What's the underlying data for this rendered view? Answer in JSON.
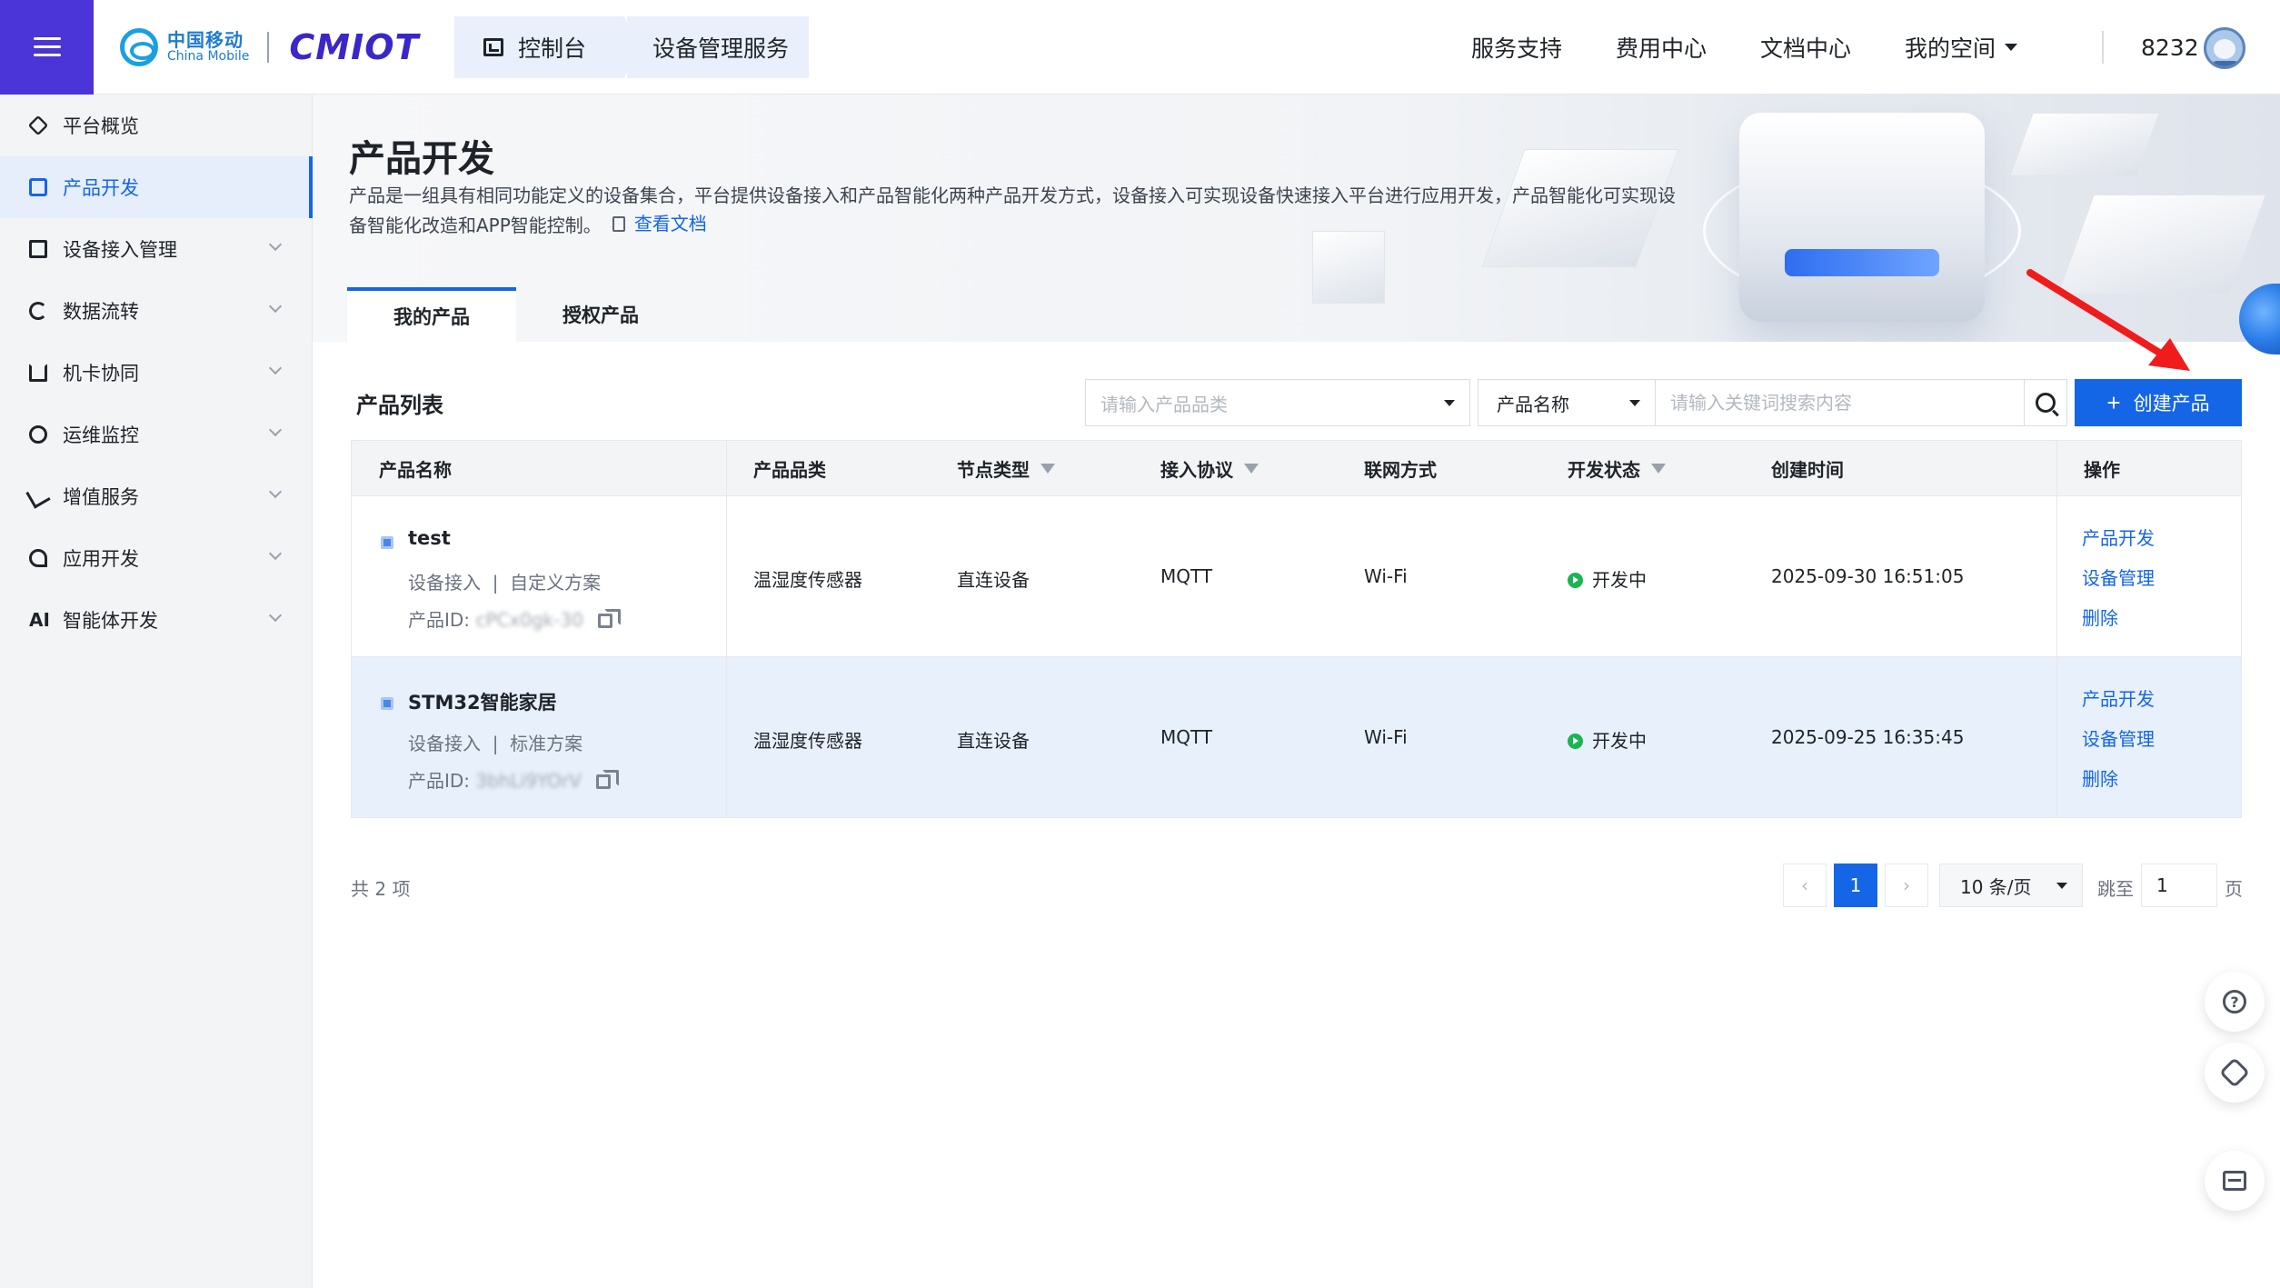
{
  "header": {
    "brand_cn": "中国移动",
    "brand_en": "China Mobile",
    "product_logo": "CMIOT",
    "breadcrumb": [
      {
        "label": "控制台",
        "icon": "console-icon"
      },
      {
        "label": "设备管理服务"
      }
    ],
    "nav": {
      "service": "服务支持",
      "fee": "费用中心",
      "docs": "文档中心",
      "space": "我的空间"
    },
    "user_id": "8232"
  },
  "sidebar": {
    "items": [
      {
        "label": "平台概览",
        "icon": "overview-icon",
        "expandable": false,
        "active": false
      },
      {
        "label": "产品开发",
        "icon": "product-icon",
        "expandable": false,
        "active": true
      },
      {
        "label": "设备接入管理",
        "icon": "device-access-icon",
        "expandable": true,
        "active": false
      },
      {
        "label": "数据流转",
        "icon": "data-flow-icon",
        "expandable": true,
        "active": false
      },
      {
        "label": "机卡协同",
        "icon": "card-sync-icon",
        "expandable": true,
        "active": false
      },
      {
        "label": "运维监控",
        "icon": "monitor-icon",
        "expandable": true,
        "active": false
      },
      {
        "label": "增值服务",
        "icon": "value-added-icon",
        "expandable": true,
        "active": false
      },
      {
        "label": "应用开发",
        "icon": "app-dev-icon",
        "expandable": true,
        "active": false
      },
      {
        "label": "智能体开发",
        "icon": "ai-icon",
        "icon_text": "AI",
        "expandable": true,
        "active": false
      }
    ]
  },
  "page": {
    "title": "产品开发",
    "description": "产品是一组具有相同功能定义的设备集合，平台提供设备接入和产品智能化两种产品开发方式，设备接入可实现设备快速接入平台进行应用开发，产品智能化可实现设备智能化改造和APP智能控制。",
    "doc_link": "查看文档",
    "tabs": [
      {
        "label": "我的产品",
        "active": true
      },
      {
        "label": "授权产品",
        "active": false
      }
    ]
  },
  "toolbar": {
    "list_title": "产品列表",
    "category_placeholder": "请输入产品品类",
    "search_field": "产品名称",
    "search_placeholder": "请输入关键词搜索内容",
    "create_label": "创建产品",
    "accent_color": "#1466e6"
  },
  "table": {
    "columns": {
      "name": "产品名称",
      "category": "产品品类",
      "node": "节点类型",
      "protocol": "接入协议",
      "network": "联网方式",
      "status": "开发状态",
      "created": "创建时间",
      "ops": "操作"
    },
    "rows": [
      {
        "name": "test",
        "access": "设备接入",
        "scheme": "自定义方案",
        "id_label": "产品ID:",
        "id_value": "cPCx0gk-30",
        "category": "温湿度传感器",
        "node": "直连设备",
        "protocol": "MQTT",
        "network": "Wi-Fi",
        "status": "开发中",
        "status_color": "#18b551",
        "created": "2025-09-30 16:51:05",
        "ops": [
          "产品开发",
          "设备管理",
          "删除"
        ]
      },
      {
        "name": "STM32智能家居",
        "access": "设备接入",
        "scheme": "标准方案",
        "id_label": "产品ID:",
        "id_value": "3bhLi9YOrV",
        "category": "温湿度传感器",
        "node": "直连设备",
        "protocol": "MQTT",
        "network": "Wi-Fi",
        "status": "开发中",
        "status_color": "#18b551",
        "created": "2025-09-25 16:35:45",
        "ops": [
          "产品开发",
          "设备管理",
          "删除"
        ]
      }
    ]
  },
  "pagination": {
    "total": "共 2 项",
    "prev": "‹",
    "current": "1",
    "next": "›",
    "page_size": "10 条/页",
    "jump_label": "跳至",
    "jump_value": "1",
    "page_label": "页"
  },
  "floating": {
    "help_icon": "?"
  }
}
